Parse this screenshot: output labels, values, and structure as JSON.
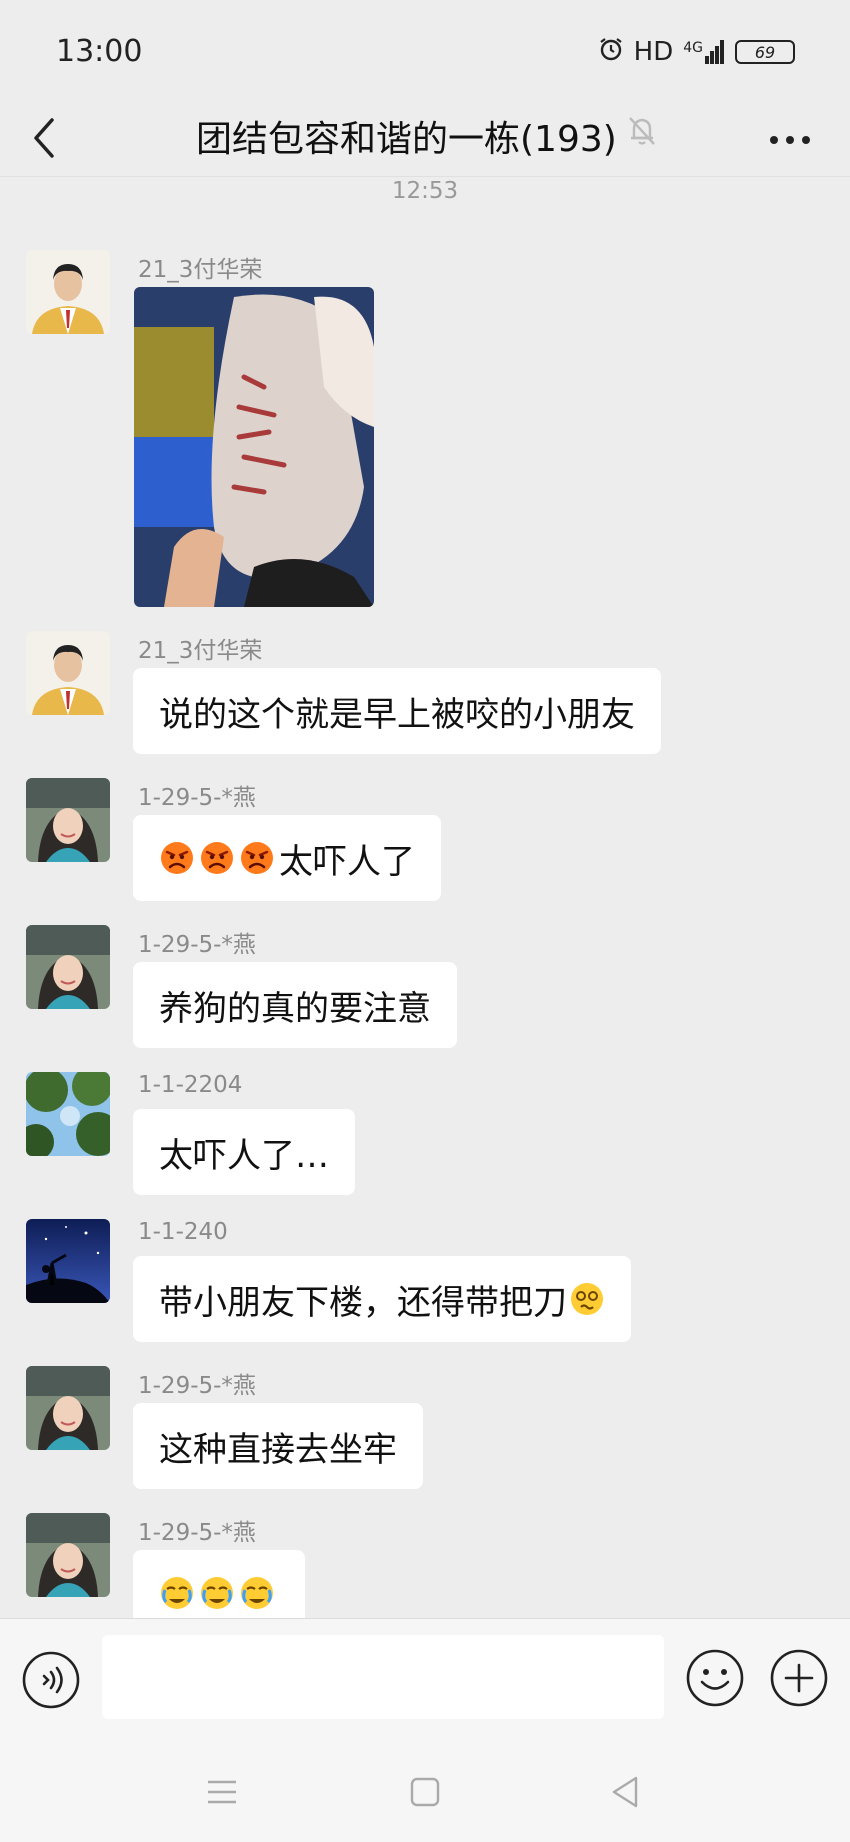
{
  "status_bar": {
    "time": "13:00",
    "hd": "HD",
    "network": "4G",
    "battery": "69"
  },
  "header": {
    "title": "团结包容和谐的一栋(193)"
  },
  "timestamp": "12:53",
  "messages": [
    {
      "sender": "21_3付华荣",
      "type": "image"
    },
    {
      "sender": "21_3付华荣",
      "text": "说的这个就是早上被咬的小朋友"
    },
    {
      "sender": "1-29-5-*燕",
      "text": "太吓人了",
      "emojis": [
        "angry",
        "angry",
        "angry"
      ]
    },
    {
      "sender": "1-29-5-*燕",
      "text": "养狗的真的要注意"
    },
    {
      "sender": "1-1-2204",
      "text": "太吓人了…"
    },
    {
      "sender": "1-1-240",
      "text": "带小朋友下楼，还得带把刀",
      "trailing_emoji": "dizzy"
    },
    {
      "sender": "1-29-5-*燕",
      "text": "这种直接去坐牢"
    },
    {
      "sender": "1-29-5-*燕",
      "text": "",
      "emojis": [
        "crying",
        "crying",
        "crying"
      ]
    }
  ],
  "input": {
    "placeholder": "",
    "value": ""
  },
  "colors": {
    "background": "#ededed",
    "bubble": "#ffffff",
    "sender": "#8a8a8a"
  }
}
